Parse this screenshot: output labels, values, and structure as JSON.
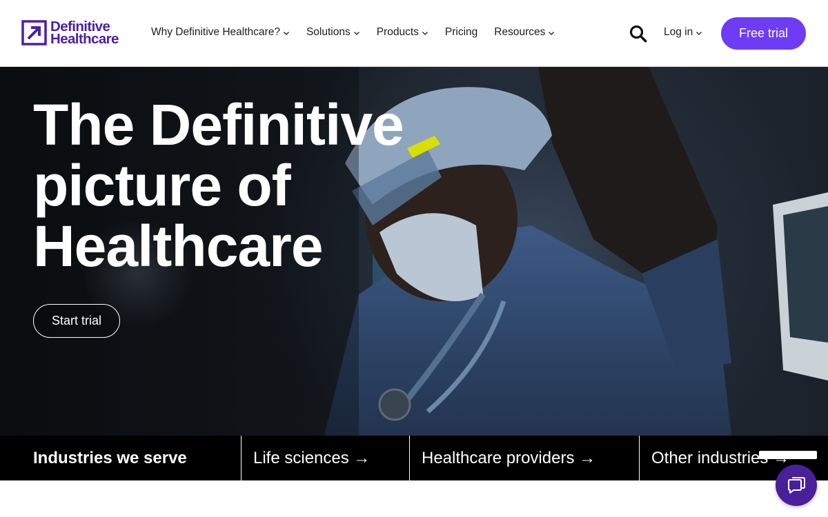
{
  "brand": {
    "line1": "Definitive",
    "line2": "Healthcare",
    "accent_color": "#6f3cf6",
    "logo_color": "#4b1fa8"
  },
  "nav": {
    "items": [
      {
        "label": "Why Definitive Healthcare?",
        "dropdown": true
      },
      {
        "label": "Solutions",
        "dropdown": true
      },
      {
        "label": "Products",
        "dropdown": true
      },
      {
        "label": "Pricing",
        "dropdown": false
      },
      {
        "label": "Resources",
        "dropdown": true
      }
    ],
    "search_icon": "search-icon",
    "login_label": "Log in",
    "cta_label": "Free trial"
  },
  "hero": {
    "title_lines": [
      "The Definitive",
      "picture of",
      "Healthcare"
    ],
    "cta_label": "Start trial"
  },
  "industries": {
    "heading": "Industries we serve",
    "links": [
      {
        "label": "Life sciences →"
      },
      {
        "label": "Healthcare providers →"
      },
      {
        "label": "Other industries →"
      }
    ]
  },
  "chat": {
    "icon": "chat-icon"
  }
}
